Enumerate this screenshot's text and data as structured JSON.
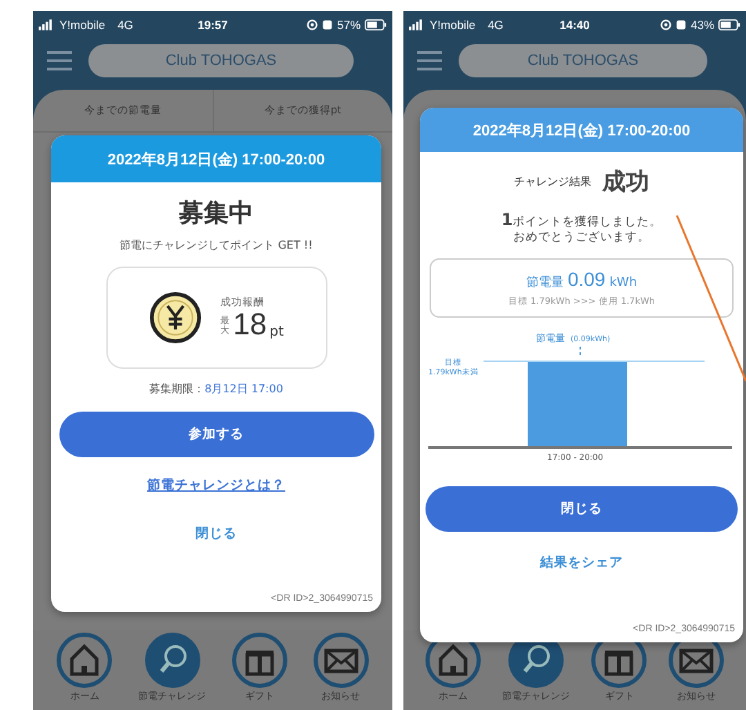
{
  "phones": [
    {
      "status_bar": {
        "carrier": "Y!mobile",
        "network": "4G",
        "time": "19:57",
        "battery": "57%"
      },
      "header": {
        "title": "Club TOHOGAS"
      },
      "background": {
        "stats": [
          "今までの節電量",
          "今までの獲得pt"
        ]
      },
      "modal": {
        "kind": "recruit",
        "date": "2022年8月12日(金) 17:00-20:00",
        "title": "募集中",
        "subtitle": "節電にチャレンジしてポイント GET !!",
        "reward": {
          "label": "成功報酬",
          "prefix": "最大",
          "value": "18",
          "unit": "pt"
        },
        "deadline": {
          "label": "募集期限：",
          "value": "8月12日 17:00"
        },
        "primary_button": "参加する",
        "link": "節電チャレンジとは？",
        "secondary_button": "閉じる",
        "id_text": "<DR ID>2_3064990715"
      },
      "nav": [
        {
          "label": "ホーム",
          "selected": false
        },
        {
          "label": "節電チャレンジ",
          "selected": true
        },
        {
          "label": "ギフト",
          "selected": false
        },
        {
          "label": "お知らせ",
          "selected": false
        }
      ]
    },
    {
      "status_bar": {
        "carrier": "Y!mobile",
        "network": "4G",
        "time": "14:40",
        "battery": "43%"
      },
      "header": {
        "title": "Club TOHOGAS"
      },
      "modal": {
        "kind": "result",
        "date": "2022年8月12日(金) 17:00-20:00",
        "result_label": "チャレンジ結果",
        "result": "成功",
        "message": [
          "**1**ポイントを獲得しました。",
          "おめでとうございます。"
        ],
        "summary": {
          "label": "節電量",
          "value": "0.09",
          "unit": "kWh",
          "detail": "目標 1.79kWh >>> 使用 1.7kWh"
        },
        "chart": {
          "bar_label": "節電量",
          "bar_value": "(0.09kWh)",
          "target_label": [
            "目標",
            "1.79kWh未満"
          ],
          "x_label": "17:00 - 20:00"
        },
        "primary_button": "閉じる",
        "secondary_link": "結果をシェア",
        "id_text": "<DR ID>2_3064990715"
      },
      "nav": [
        {
          "label": "ホーム",
          "selected": false
        },
        {
          "label": "節電チャレンジ",
          "selected": true
        },
        {
          "label": "ギフト",
          "selected": false
        },
        {
          "label": "お知らせ",
          "selected": false
        }
      ]
    }
  ]
}
